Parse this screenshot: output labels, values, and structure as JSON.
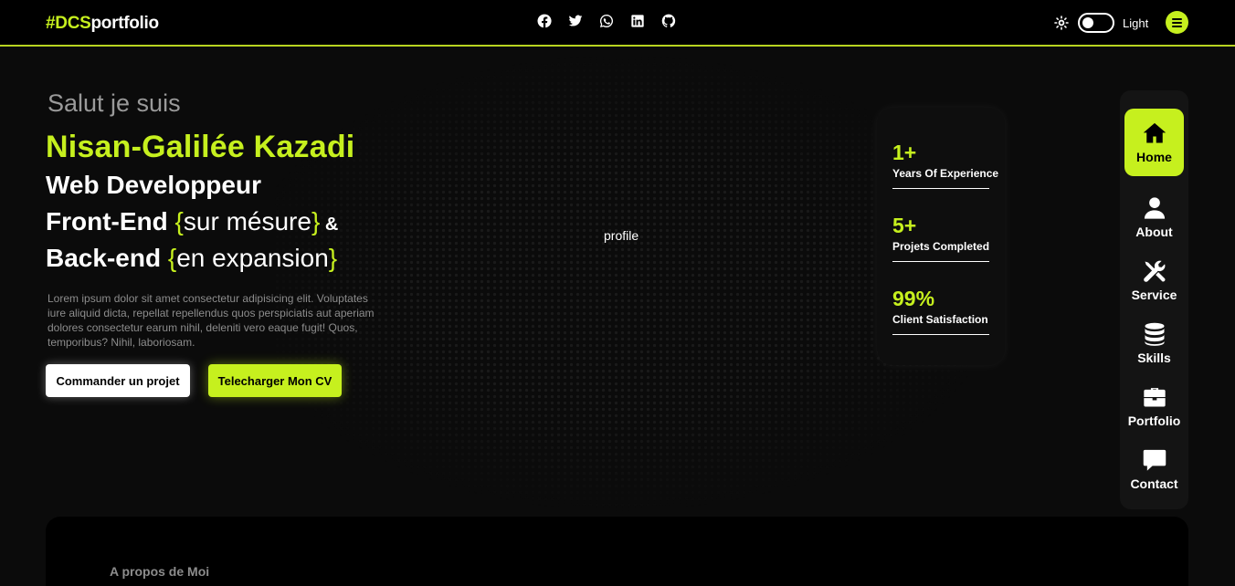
{
  "header": {
    "logo_accent": "#DCS",
    "logo_rest": "portfolio",
    "socials": [
      "facebook-icon",
      "twitter-icon",
      "whatsapp-icon",
      "linkedin-icon",
      "github-icon"
    ],
    "theme_label": "Light",
    "theme_toggle_on": false
  },
  "hero": {
    "greeting": "Salut je suis",
    "name": "Nisan-Galilée Kazadi",
    "role1": "Web Developpeur",
    "role2_prefix": "Front-End ",
    "role2_brace_open": "{",
    "role2_highlight": "sur mésure",
    "role2_brace_close": "}",
    "role2_suffix": " &",
    "role3_prefix": "Back-end ",
    "role3_brace_open": "{",
    "role3_highlight": "en expansion",
    "role3_brace_close": "}",
    "description": "Lorem ipsum dolor sit amet consectetur adipisicing elit. Voluptates iure aliquid dicta, repellat repellendus quos perspiciatis aut aperiam dolores consectetur earum nihil, deleniti vero eaque fugit! Quos, temporibus? Nihil, laboriosam.",
    "btn_order": "Commander un projet",
    "btn_cv": "Telecharger Mon CV",
    "profile_alt": "profile"
  },
  "stats": [
    {
      "value": "1+",
      "label": "Years Of Experience"
    },
    {
      "value": "5+",
      "label": "Projets Completed"
    },
    {
      "value": "99%",
      "label": "Client Satisfaction"
    }
  ],
  "nav": {
    "items": [
      {
        "label": "Home",
        "icon": "home-icon",
        "active": true
      },
      {
        "label": "About",
        "icon": "user-icon",
        "active": false
      },
      {
        "label": "Service",
        "icon": "tools-icon",
        "active": false
      },
      {
        "label": "Skills",
        "icon": "database-icon",
        "active": false
      },
      {
        "label": "Portfolio",
        "icon": "briefcase-icon",
        "active": false
      },
      {
        "label": "Contact",
        "icon": "chat-icon",
        "active": false
      }
    ]
  },
  "about": {
    "title": "A propos de Moi"
  },
  "colors": {
    "accent": "#c6f01e",
    "background": "#0b0b0b"
  }
}
